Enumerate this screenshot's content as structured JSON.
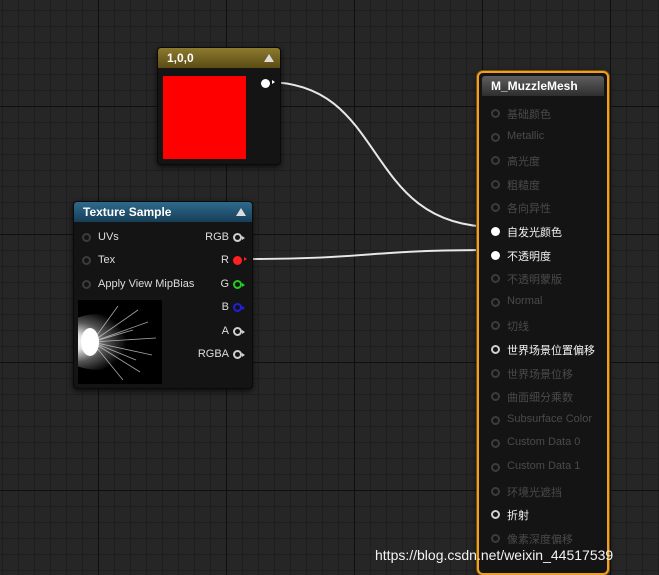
{
  "constant_node": {
    "title": "1,0,0",
    "color": "#ff0000"
  },
  "texture_node": {
    "title": "Texture Sample",
    "inputs": [
      "UVs",
      "Tex",
      "Apply View MipBias"
    ],
    "outputs": [
      {
        "label": "RGB",
        "color": "#d0d0d0"
      },
      {
        "label": "R",
        "color": "#ff2020"
      },
      {
        "label": "G",
        "color": "#20d020"
      },
      {
        "label": "B",
        "color": "#2020e0"
      },
      {
        "label": "A",
        "color": "#d0d0d0"
      },
      {
        "label": "RGBA",
        "color": "#d0d0d0"
      }
    ]
  },
  "material_node": {
    "title": "M_MuzzleMesh",
    "inputs": [
      {
        "label": "基础颜色",
        "active": false,
        "connected": false
      },
      {
        "label": "Metallic",
        "active": false,
        "connected": false
      },
      {
        "label": "高光度",
        "active": false,
        "connected": false
      },
      {
        "label": "粗糙度",
        "active": false,
        "connected": false
      },
      {
        "label": "各向异性",
        "active": false,
        "connected": false
      },
      {
        "label": "自发光颜色",
        "active": true,
        "connected": true
      },
      {
        "label": "不透明度",
        "active": true,
        "connected": true
      },
      {
        "label": "不透明蒙版",
        "active": false,
        "connected": false
      },
      {
        "label": "Normal",
        "active": false,
        "connected": false
      },
      {
        "label": "切线",
        "active": false,
        "connected": false
      },
      {
        "label": "世界场景位置偏移",
        "active": true,
        "connected": false
      },
      {
        "label": "世界场景位移",
        "active": false,
        "connected": false
      },
      {
        "label": "曲面细分乘数",
        "active": false,
        "connected": false
      },
      {
        "label": "Subsurface Color",
        "active": false,
        "connected": false
      },
      {
        "label": "Custom Data 0",
        "active": false,
        "connected": false
      },
      {
        "label": "Custom Data 1",
        "active": false,
        "connected": false
      },
      {
        "label": "环境光遮挡",
        "active": false,
        "connected": false
      },
      {
        "label": "折射",
        "active": true,
        "connected": false
      },
      {
        "label": "像素深度偏移",
        "active": false,
        "connected": false
      }
    ]
  },
  "watermark": "https://blog.csdn.net/weixin_44517539"
}
